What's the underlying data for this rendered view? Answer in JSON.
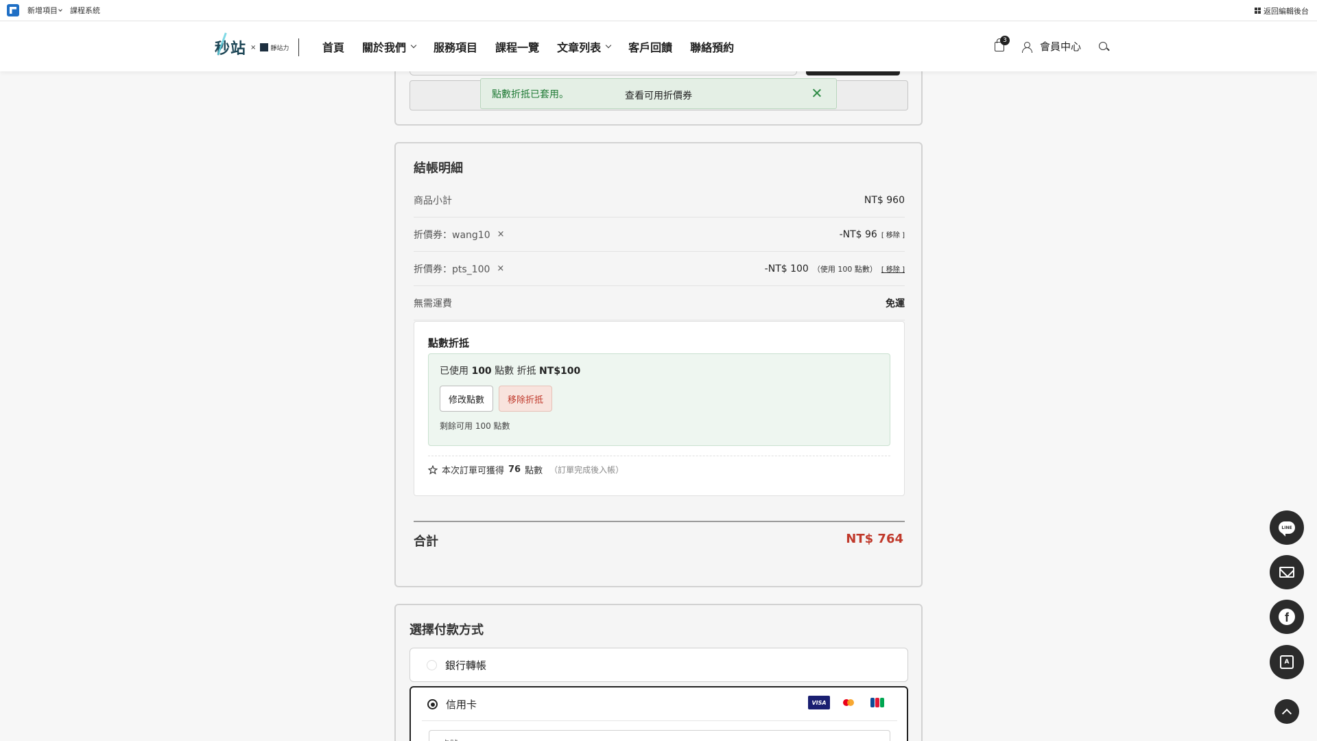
{
  "adminbar": {
    "new_item": "新增項目",
    "course_system": "課程系統",
    "back_to_admin": "返回編輯後台"
  },
  "header": {
    "brand_main": "秒站",
    "brand_x": "×",
    "brand_sub": "靜站力",
    "nav": [
      {
        "label": "首頁"
      },
      {
        "label": "關於我們"
      },
      {
        "label": "服務項目"
      },
      {
        "label": "課程一覽"
      },
      {
        "label": "文章列表"
      },
      {
        "label": "客戶回饋"
      },
      {
        "label": "聯絡預約"
      }
    ],
    "cart_count": "3",
    "member_center": "會員中心"
  },
  "coupon_card": {
    "view_coupons": "查看可用折價券"
  },
  "toast": {
    "message": "點數折抵已套用。"
  },
  "checkout": {
    "title": "結帳明細",
    "subtotal_label": "商品小計",
    "subtotal_value": "NT$ 960",
    "coupon1_label": "折價券：wang10",
    "coupon1_remove_x": "×",
    "coupon1_value": "-NT$ 96",
    "coupon1_remove": "[ 移除 ]",
    "coupon2_label": "折價券：pts_100",
    "coupon2_remove_x": "×",
    "coupon2_value": "-NT$ 100",
    "coupon2_note": "（使用 100 點數）",
    "coupon2_remove": "[ 移除 ]",
    "shipping_label": "無需運費",
    "shipping_value": "免運",
    "points": {
      "title": "點數折抵",
      "used_prefix": "已使用",
      "used_points": "100",
      "used_mid": "點數 折抵",
      "used_amount": "NT$100",
      "edit_button": "修改點數",
      "remove_button": "移除折抵",
      "remaining": "剩餘可用 100 點數",
      "earn_prefix": "本次訂單可獲得",
      "earn_points": "76",
      "earn_suffix": "點數",
      "earn_note": "（訂單完成後入帳）"
    },
    "total_label": "合計",
    "total_value": "NT$ 764"
  },
  "payment": {
    "title": "選擇付款方式",
    "bank_transfer": "銀行轉帳",
    "credit_card": "信用卡",
    "card_logos": [
      "VISA",
      "Mastercard",
      "JCB"
    ],
    "card_number_placeholder": "卡號"
  },
  "floating": [
    "line-icon",
    "mail-icon",
    "facebook-icon",
    "form-icon",
    "arrow-up-icon"
  ],
  "colors": {
    "accent_red": "#c0392b",
    "toast_green": "#1f7a35",
    "dark": "#2b2b2b"
  }
}
